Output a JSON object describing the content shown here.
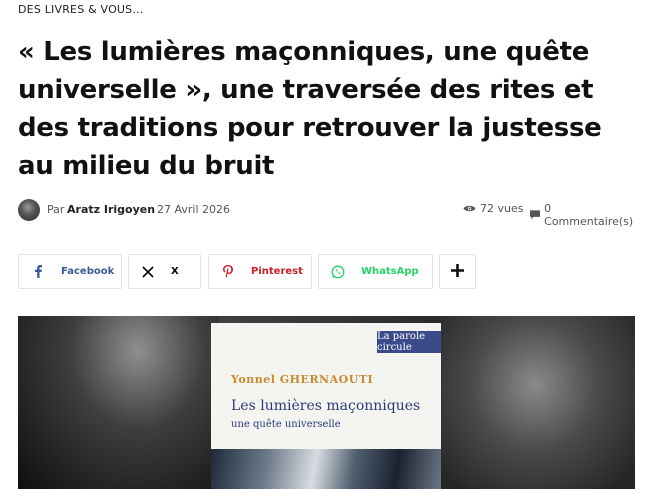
{
  "article": {
    "category": "DES LIVRES & VOUS…",
    "title": "« Les lumières maçonniques, une quête universelle », une traversée des rites et des traditions pour retrouver la justesse au milieu du bruit",
    "meta": {
      "by_prefix": "Par",
      "author": "Aratz Irigoyen",
      "date": "27 Avril 2026",
      "views": "72 vues",
      "comments": "0 Commentaire(s)"
    }
  },
  "share": {
    "facebook": {
      "label": "Facebook",
      "icon": "facebook-icon",
      "color": "#3b5998"
    },
    "x": {
      "label": "X",
      "icon": "x-icon",
      "color": "#000000"
    },
    "pinterest": {
      "label": "Pinterest",
      "icon": "pinterest-icon",
      "color": "#cb2027"
    },
    "whatsapp": {
      "label": "WhatsApp",
      "icon": "whatsapp-icon",
      "color": "#25d366"
    },
    "more": {
      "icon": "plus-icon"
    }
  },
  "hero": {
    "cover": {
      "publisher_tag": "La parole circule",
      "author": "Yonnel GHERNAOUTI",
      "title": "Les lumières maçonniques",
      "subtitle": "une quête universelle"
    }
  }
}
